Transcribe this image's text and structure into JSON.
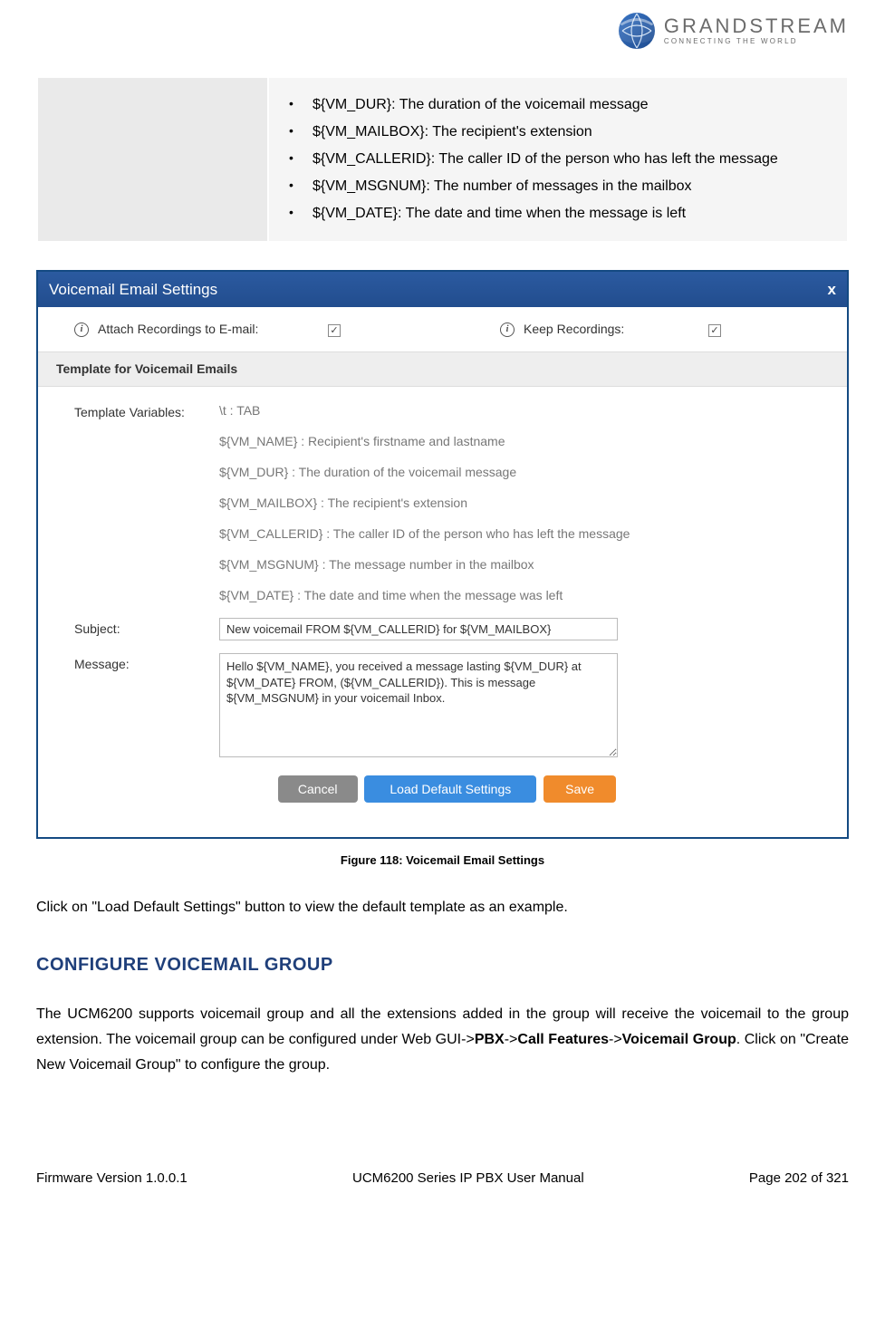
{
  "logo": {
    "brand": "GRANDSTREAM",
    "tagline": "CONNECTING THE WORLD"
  },
  "variables": [
    "${VM_DUR}: The duration of the voicemail message",
    "${VM_MAILBOX}: The recipient's extension",
    "${VM_CALLERID}: The caller ID of the person who has left the message",
    "${VM_MSGNUM}: The number of messages in the mailbox",
    "${VM_DATE}: The date and time when the message is left"
  ],
  "screenshot": {
    "title": "Voicemail Email Settings",
    "close": "x",
    "attach_label": "Attach Recordings to E-mail:",
    "keep_label": "Keep Recordings:",
    "attach_checked": "✓",
    "keep_checked": "✓",
    "section_hdr": "Template for Voicemail Emails",
    "tv_label": "Template Variables:",
    "tv_items": [
      "\\t : TAB",
      "${VM_NAME} : Recipient's firstname and lastname",
      "${VM_DUR} : The duration of the voicemail message",
      "${VM_MAILBOX} : The recipient's extension",
      "${VM_CALLERID} : The caller ID of the person who has left the message",
      "${VM_MSGNUM} : The message number in the mailbox",
      "${VM_DATE} : The date and time when the message was left"
    ],
    "subject_label": "Subject:",
    "subject_value": "New voicemail FROM ${VM_CALLERID} for ${VM_MAILBOX}",
    "message_label": "Message:",
    "message_value": "Hello ${VM_NAME}, you received a message lasting ${VM_DUR} at ${VM_DATE} FROM, (${VM_CALLERID}). This is message ${VM_MSGNUM} in your voicemail Inbox.",
    "btn_cancel": "Cancel",
    "btn_load": "Load Default Settings",
    "btn_save": "Save"
  },
  "figure_caption": "Figure 118: Voicemail Email Settings",
  "para1": "Click on \"Load Default Settings\" button to view the default template as an example.",
  "heading": "CONFIGURE VOICEMAIL GROUP",
  "para2_a": "The UCM6200 supports voicemail group and all the extensions added in the group will receive the voicemail to the group extension. The voicemail group can be configured under Web GUI->",
  "para2_b": "PBX",
  "para2_c": "->",
  "para2_d": "Call Features",
  "para2_e": "->",
  "para2_f": "Voicemail Group",
  "para2_g": ". Click on \"Create New Voicemail Group\" to configure the group.",
  "footer": {
    "left": "Firmware Version 1.0.0.1",
    "center": "UCM6200 Series IP PBX User Manual",
    "right": "Page 202 of 321"
  }
}
